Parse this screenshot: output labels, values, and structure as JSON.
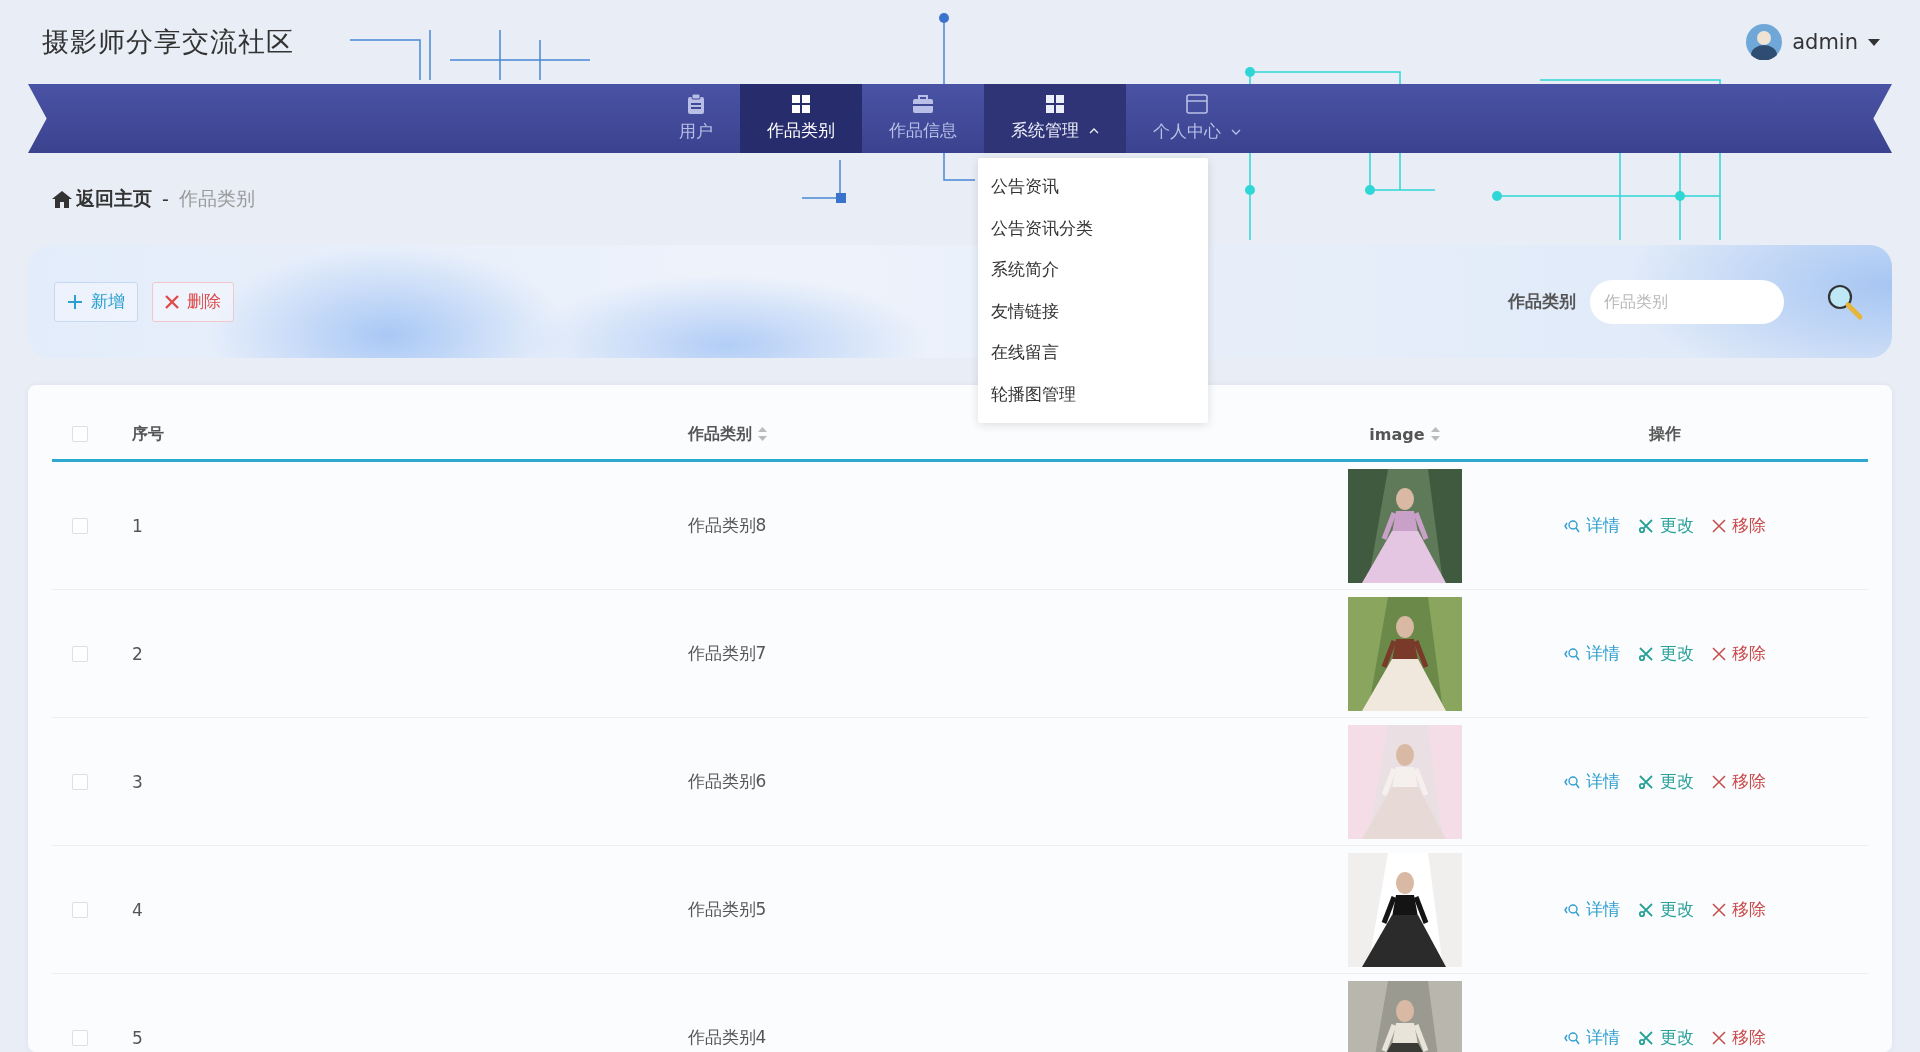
{
  "site_title": "摄影师分享交流社区",
  "user": {
    "name": "admin"
  },
  "nav": {
    "items": [
      {
        "label": "用户",
        "selected": false
      },
      {
        "label": "作品类别",
        "selected": true
      },
      {
        "label": "作品信息",
        "selected": false
      },
      {
        "label": "系统管理",
        "selected": false,
        "expanded": true,
        "children": [
          {
            "label": "公告资讯"
          },
          {
            "label": "公告资讯分类"
          },
          {
            "label": "系统简介"
          },
          {
            "label": "友情链接"
          },
          {
            "label": "在线留言"
          },
          {
            "label": "轮播图管理"
          }
        ]
      },
      {
        "label": "个人中心",
        "selected": false,
        "expanded": false
      }
    ]
  },
  "breadcrumb": {
    "home": "返回主页",
    "separator": "-",
    "current": "作品类别"
  },
  "toolbar": {
    "buttons": [
      {
        "kind": "add",
        "label": "新增"
      },
      {
        "kind": "delete",
        "label": "删除"
      }
    ],
    "search": {
      "label": "作品类别",
      "placeholder": "作品类别"
    }
  },
  "table": {
    "all_checked": false,
    "columns": [
      {
        "label": "序号",
        "sortable": false
      },
      {
        "label": "作品类别",
        "sortable": true
      },
      {
        "label": "image",
        "sortable": true
      },
      {
        "label": "操作",
        "sortable": false
      }
    ],
    "rows": [
      {
        "index": "1",
        "category": "作品类别8",
        "checked": false,
        "actions": [
          {
            "kind": "detail",
            "label": "详情"
          },
          {
            "kind": "edit",
            "label": "更改"
          },
          {
            "kind": "remove",
            "label": "移除"
          }
        ]
      },
      {
        "index": "2",
        "category": "作品类别7",
        "checked": false,
        "actions": [
          {
            "kind": "detail",
            "label": "详情"
          },
          {
            "kind": "edit",
            "label": "更改"
          },
          {
            "kind": "remove",
            "label": "移除"
          }
        ]
      },
      {
        "index": "3",
        "category": "作品类别6",
        "checked": false,
        "actions": [
          {
            "kind": "detail",
            "label": "详情"
          },
          {
            "kind": "edit",
            "label": "更改"
          },
          {
            "kind": "remove",
            "label": "移除"
          }
        ]
      },
      {
        "index": "4",
        "category": "作品类别5",
        "checked": false,
        "actions": [
          {
            "kind": "detail",
            "label": "详情"
          },
          {
            "kind": "edit",
            "label": "更改"
          },
          {
            "kind": "remove",
            "label": "移除"
          }
        ]
      },
      {
        "index": "5",
        "category": "作品类别4",
        "checked": false,
        "actions": [
          {
            "kind": "detail",
            "label": "详情"
          },
          {
            "kind": "edit",
            "label": "更改"
          },
          {
            "kind": "remove",
            "label": "移除"
          }
        ]
      }
    ]
  }
}
